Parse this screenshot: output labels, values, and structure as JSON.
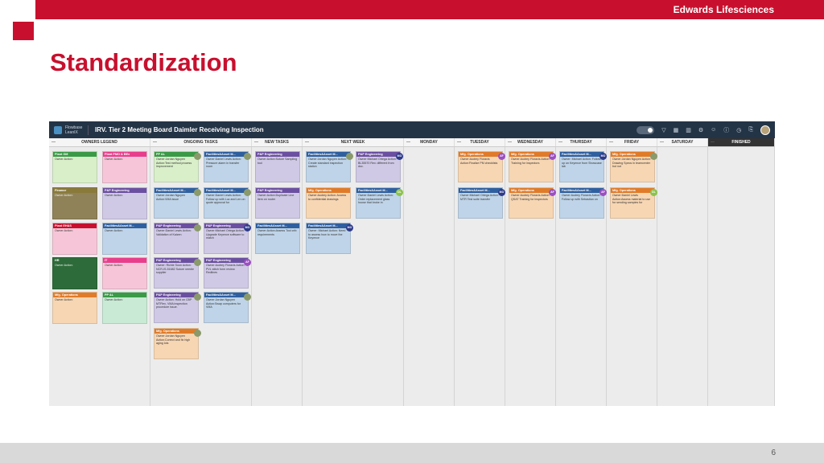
{
  "brand": "Edwards Lifesciences",
  "slide_title": "Standardization",
  "page_number": "6",
  "app": {
    "logo_text": "Flowbase LeanIX",
    "board_title": "IRV. Tier 2 Meeting Board Daimler Receiving Inspection",
    "toolbar_icons": [
      "toggle-icon",
      "filter-icon",
      "grid-icon",
      "chart-icon",
      "settings-icon",
      "users-icon",
      "info-icon",
      "clock-icon",
      "share-icon",
      "user-avatar"
    ]
  },
  "columns": [
    {
      "key": "owners",
      "label": "OWNERS LEGEND"
    },
    {
      "key": "ongoing",
      "label": "ONGOING TASKS"
    },
    {
      "key": "new",
      "label": "NEW TASKS"
    },
    {
      "key": "next",
      "label": "NEXT WEEK"
    },
    {
      "key": "mon",
      "label": "MONDAY"
    },
    {
      "key": "tue",
      "label": "TUESDAY"
    },
    {
      "key": "wed",
      "label": "WEDNESDAY"
    },
    {
      "key": "thu",
      "label": "THURSDAY"
    },
    {
      "key": "fri",
      "label": "FRIDAY"
    },
    {
      "key": "sat",
      "label": "SATURDAY"
    },
    {
      "key": "fin",
      "label": "FINISHED"
    }
  ],
  "colors": {
    "red": "#c8102e",
    "green": "#3a9a47",
    "pink": "#e83e8c",
    "olive": "#8a7a3a",
    "blue": "#2f5f9f",
    "purple": "#6b4fa0",
    "orange": "#e07b2a",
    "darkgreen": "#2e6b3a",
    "bg_green": "#d8efc9",
    "bg_pink": "#f6c6d8",
    "bg_olive": "#8f8258",
    "bg_blue": "#bfd4e8",
    "bg_lav": "#cfc9e6",
    "bg_orange": "#f7d6b3",
    "bg_dgreen": "#2e6b3a",
    "bg_mint": "#c9ead5"
  },
  "cards": [
    {
      "col": 0,
      "sub": 0,
      "row": 0,
      "hd": "Plant GM",
      "hc": "green",
      "bc": "bg_green",
      "body": "Owner:Action:"
    },
    {
      "col": 0,
      "sub": 1,
      "row": 0,
      "hd": "Plant PMO & BEx",
      "hc": "pink",
      "bc": "bg_pink",
      "body": "Owner:Action:"
    },
    {
      "col": 0,
      "sub": 0,
      "row": 1,
      "hd": "Finance",
      "hc": "olive",
      "bc": "bg_olive",
      "body": "Owner:Action:"
    },
    {
      "col": 0,
      "sub": 1,
      "row": 1,
      "hd": "P&P Engineering",
      "hc": "purple",
      "bc": "bg_lav",
      "body": "Owner:Action:"
    },
    {
      "col": 0,
      "sub": 0,
      "row": 2,
      "hd": "Plant EH&S",
      "hc": "red",
      "bc": "bg_pink",
      "body": "Owner:Action:"
    },
    {
      "col": 0,
      "sub": 1,
      "row": 2,
      "hd": "Facilities&Asset M...",
      "hc": "blue",
      "bc": "bg_blue",
      "body": "Owner:Action:"
    },
    {
      "col": 0,
      "sub": 0,
      "row": 3,
      "hd": "HR",
      "hc": "darkgreen",
      "bc": "bg_dgreen",
      "body": "Owner:Action:"
    },
    {
      "col": 0,
      "sub": 1,
      "row": 3,
      "hd": "IT",
      "hc": "pink",
      "bc": "bg_pink",
      "body": "Owner:Action:"
    },
    {
      "col": 0,
      "sub": 0,
      "row": 4,
      "hd": "Mfg. Operations",
      "hc": "orange",
      "bc": "bg_orange",
      "body": "Owner:Action:"
    },
    {
      "col": 0,
      "sub": 1,
      "row": 4,
      "hd": "PP &L",
      "hc": "green",
      "bc": "bg_mint",
      "body": "Owner:Action:"
    },
    {
      "col": 1,
      "sub": 0,
      "row": 0,
      "hd": "PP &L",
      "hc": "green",
      "bc": "bg_green",
      "body": "Owner:Jordan Nguyen Action:Test method process improvement",
      "av": "photo"
    },
    {
      "col": 1,
      "sub": 1,
      "row": 0,
      "hd": "Facilities&Asset M...",
      "hc": "blue",
      "bc": "bg_blue",
      "body": "Owner:Daniel Lewis Action: Pressure alarm in transfer room",
      "av": "photo"
    },
    {
      "col": 1,
      "sub": 0,
      "row": 1,
      "hd": "Facilities&Asset M...",
      "hc": "blue",
      "bc": "bg_blue",
      "body": "Owner:Jordan Nguyen Action:VMA issue",
      "av": "photo"
    },
    {
      "col": 1,
      "sub": 1,
      "row": 1,
      "hd": "Facilities&Asset M...",
      "hc": "blue",
      "bc": "bg_blue",
      "body": "Owner:Daniel Lewis Action: Follow up with Luz and Len on quote approval for",
      "av": "photo"
    },
    {
      "col": 1,
      "sub": 0,
      "row": 2,
      "hd": "P&P Engineering",
      "hc": "purple",
      "bc": "bg_lav",
      "body": "Owner:Daniel Lewis Action: Validation of Kaizen",
      "av": "photo"
    },
    {
      "col": 1,
      "sub": 1,
      "row": 2,
      "hd": "P&P Engineering",
      "hc": "purple",
      "bc": "bg_lav",
      "body": "Owner:Michael Ortega Action: Upgrade Keyence software to match",
      "av": "m",
      "avt": "MO"
    },
    {
      "col": 1,
      "sub": 0,
      "row": 3,
      "hd": "P&P Engineering",
      "hc": "purple",
      "bc": "bg_lav",
      "body": "Owner: Richie Soon Action: NCR-IS-51682 Suture needle supplier",
      "av": "photo"
    },
    {
      "col": 1,
      "sub": 1,
      "row": 3,
      "hd": "P&P Engineering",
      "hc": "purple",
      "bc": "bg_lav",
      "body": "Owner:Audrey Floravis Action: PVL stitch form review. Redlines",
      "av": "p",
      "avt": "AF"
    },
    {
      "col": 1,
      "sub": 0,
      "row": 4,
      "hd": "P&P Engineering",
      "hc": "purple",
      "bc": "bg_lav",
      "body": "Owner:Action: Hold on CBP MTFlex, VMA inspection procedure issue.",
      "av": "photo"
    },
    {
      "col": 1,
      "sub": 1,
      "row": 4,
      "hd": "Facilities&Asset M...",
      "hc": "blue",
      "bc": "bg_blue",
      "body": "Owner:Jordan Nguyen Action:Swap computers for VMA",
      "av": "photo"
    },
    {
      "col": 1,
      "sub": 0,
      "row": 5,
      "hd": "Mfg. Operations",
      "hc": "orange",
      "bc": "bg_orange",
      "body": "Owner:Jordan Nguyen Action:Correct and fix high aging lots",
      "av": "photo"
    },
    {
      "col": 2,
      "sub": 0,
      "row": 0,
      "hd": "P&P Engineering",
      "hc": "purple",
      "bc": "bg_lav",
      "body": "Owner:Action:Suture Sampling tool"
    },
    {
      "col": 2,
      "sub": 0,
      "row": 1,
      "hd": "P&P Engineering",
      "hc": "purple",
      "bc": "bg_lav",
      "body": "Owner:Action:Duplicate Line item on router"
    },
    {
      "col": 2,
      "sub": 0,
      "row": 2,
      "hd": "Facilities&Asset M...",
      "hc": "blue",
      "bc": "bg_blue",
      "body": "Owner:Action:Assess Tool crib requirements"
    },
    {
      "col": 3,
      "sub": 0,
      "row": 0,
      "hd": "Facilities&Asset M...",
      "hc": "blue",
      "bc": "bg_blue",
      "body": "Owner:Jordan Nguyen Action: Create standard inspection station",
      "av": "photo"
    },
    {
      "col": 3,
      "sub": 1,
      "row": 0,
      "hd": "P&P Engineering",
      "hc": "purple",
      "bc": "bg_lav",
      "body": "Owner:Michael Ortega Action: BL35570 Rev. different from doc.",
      "av": "m",
      "avt": "MO"
    },
    {
      "col": 3,
      "sub": 0,
      "row": 1,
      "hd": "Mfg. Operations",
      "hc": "orange",
      "bc": "bg_orange",
      "body": "Owner:Audrey Action: Access to confidential drawings"
    },
    {
      "col": 3,
      "sub": 1,
      "row": 1,
      "hd": "Facilities&Asset M...",
      "hc": "blue",
      "bc": "bg_blue",
      "body": "Owner:Daniel Lewis Action: Order replacement glass house that broke in",
      "av": "g",
      "avt": "DL"
    },
    {
      "col": 3,
      "sub": 0,
      "row": 2,
      "hd": "Facilities&Asset M...",
      "hc": "blue",
      "bc": "bg_blue",
      "body": "Owner: Michael Action: Need to assess how to move the Keyence",
      "av": "m",
      "avt": "MO"
    },
    {
      "col": 5,
      "sub": 0,
      "row": 0,
      "hd": "Mfg. Operations",
      "hc": "orange",
      "bc": "bg_orange",
      "body": "Owner:Audrey Floravis Action:Finalize PM checklists",
      "av": "p",
      "avt": "AF"
    },
    {
      "col": 5,
      "sub": 0,
      "row": 1,
      "hd": "Facilities&Asset M...",
      "hc": "blue",
      "bc": "bg_blue",
      "body": "Owner:Michael Ortega Action: MTR Test suite transfer",
      "av": "m",
      "avt": "MO"
    },
    {
      "col": 6,
      "sub": 0,
      "row": 0,
      "hd": "Mfg. Operations",
      "hc": "orange",
      "bc": "bg_orange",
      "body": "Owner:Audrey Floravis Action: Training for inspectors",
      "av": "p",
      "avt": "AF"
    },
    {
      "col": 6,
      "sub": 0,
      "row": 1,
      "hd": "Mfg. Operations",
      "hc": "orange",
      "bc": "bg_orange",
      "body": "Owner:Audrey Floravis Action: QSAT Training for inspectors",
      "av": "p",
      "avt": "AF"
    },
    {
      "col": 7,
      "sub": 0,
      "row": 0,
      "hd": "Facilities&Asset M...",
      "hc": "blue",
      "bc": "bg_blue",
      "body": "Owner: Michael Action: Follow-up on Keyence from Showcase lab",
      "av": "m",
      "avt": "MO"
    },
    {
      "col": 7,
      "sub": 0,
      "row": 1,
      "hd": "Facilities&Asset M...",
      "hc": "blue",
      "bc": "bg_blue",
      "body": "Owner:Audrey Floravis Action: Follow up with Sebastian on",
      "av": "p",
      "avt": "AF"
    },
    {
      "col": 8,
      "sub": 0,
      "row": 0,
      "hd": "Mfg. Operations",
      "hc": "orange",
      "bc": "bg_orange",
      "body": "Owner:Jordan Nguyen Action: Drawing Specs in teamcenter but not",
      "av": "photo"
    },
    {
      "col": 8,
      "sub": 0,
      "row": 1,
      "hd": "Mfg. Operations",
      "hc": "orange",
      "bc": "bg_orange",
      "body": "Owner:Daniel Lewis Action:Assess material to use for sending samples for",
      "av": "g",
      "avt": "DL"
    }
  ]
}
